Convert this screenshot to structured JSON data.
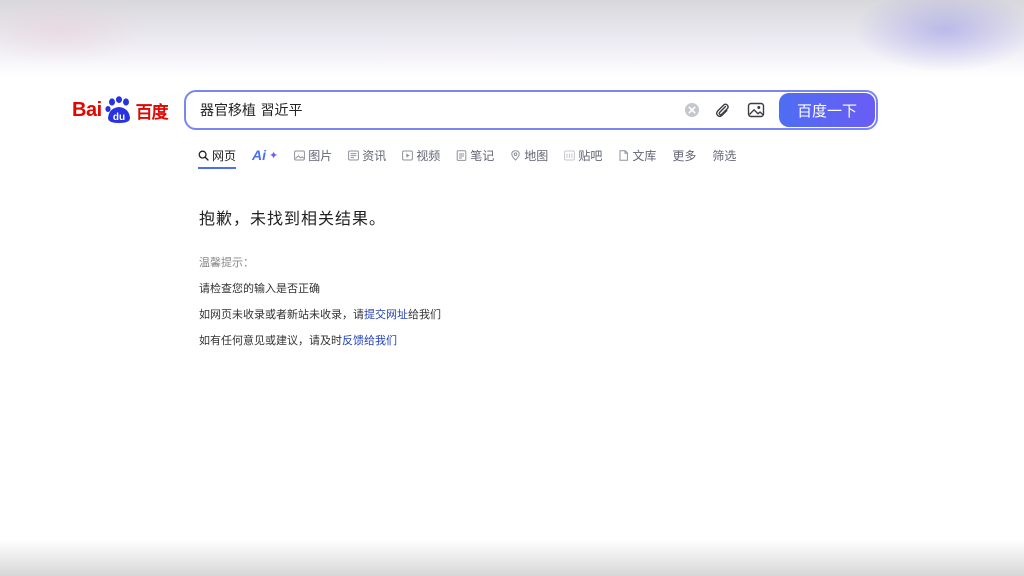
{
  "logo": {
    "latin": "Bai",
    "paw_text": "du",
    "chinese": "百度",
    "color": "#e10601"
  },
  "search": {
    "query": "器官移植 習近平",
    "button_label": "百度一下",
    "accent": "#4e6ef2",
    "icons": [
      "clear-icon",
      "paperclip-icon",
      "image-search-icon"
    ]
  },
  "tabs": [
    {
      "label": "网页",
      "icon": "search-icon",
      "active": true
    },
    {
      "label": "Ai+",
      "icon": "ai-icon"
    },
    {
      "label": "图片",
      "icon": "image-icon"
    },
    {
      "label": "资讯",
      "icon": "news-icon"
    },
    {
      "label": "视频",
      "icon": "video-icon"
    },
    {
      "label": "笔记",
      "icon": "note-icon"
    },
    {
      "label": "地图",
      "icon": "map-icon"
    },
    {
      "label": "贴吧",
      "icon": "tieba-icon"
    },
    {
      "label": "文库",
      "icon": "library-icon"
    },
    {
      "label": "更多"
    },
    {
      "label": "筛选"
    }
  ],
  "result": {
    "headline": "抱歉，未找到相关结果。",
    "hint_title": "温馨提示：",
    "hint1": "请检查您的输入是否正确",
    "hint2_prefix": "如网页未收录或者新站未收录，请",
    "hint2_link": "提交网址",
    "hint2_suffix": "给我们",
    "hint3_prefix": "如有任何意见或建议，请及时",
    "hint3_link": "反馈给我们",
    "link_color": "#2440b3"
  }
}
